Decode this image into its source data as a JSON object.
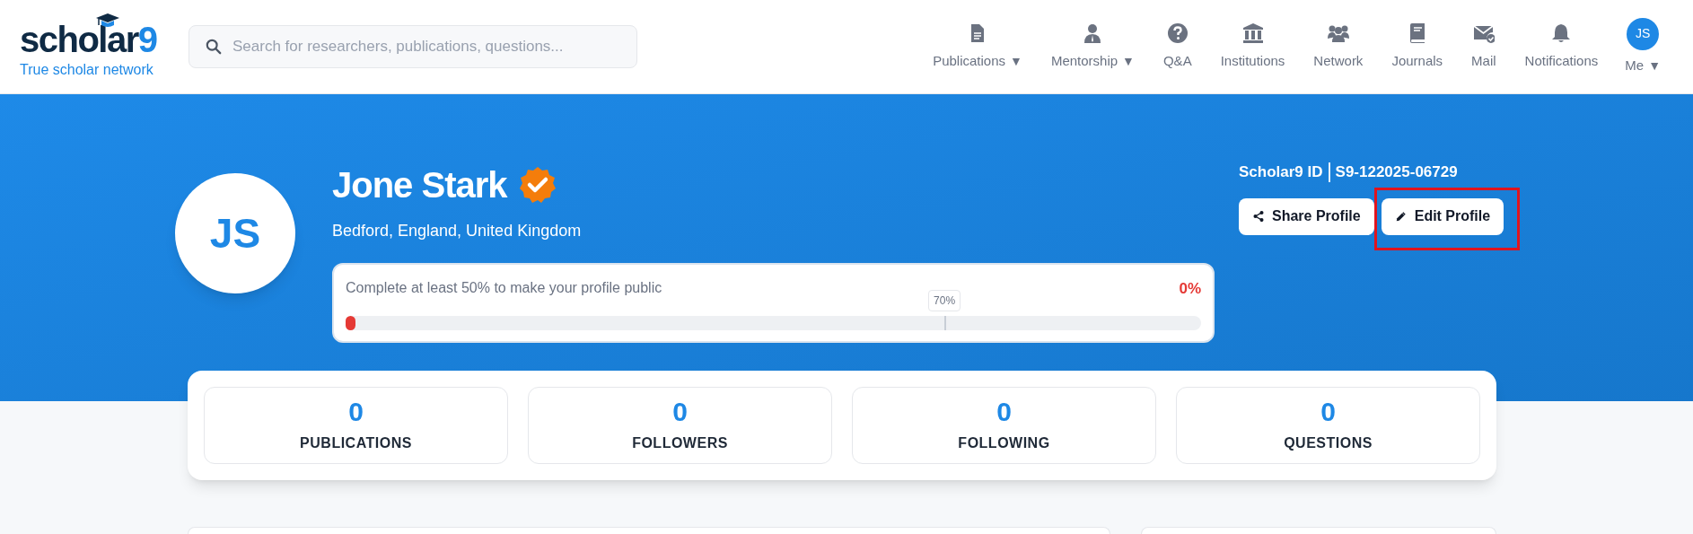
{
  "header": {
    "logo": {
      "name": "scholar",
      "digit": "9",
      "tagline": "True scholar network"
    },
    "search": {
      "placeholder": "Search for researchers, publications, questions..."
    },
    "nav": [
      {
        "kind": "doc",
        "label": "Publications",
        "caret": "▼"
      },
      {
        "kind": "person",
        "label": "Mentorship",
        "caret": "▼"
      },
      {
        "kind": "question",
        "label": "Q&A"
      },
      {
        "kind": "bank",
        "label": "Institutions"
      },
      {
        "kind": "group",
        "label": "Network"
      },
      {
        "kind": "book",
        "label": "Journals"
      },
      {
        "kind": "mail",
        "label": "Mail"
      },
      {
        "kind": "bell",
        "label": "Notifications"
      },
      {
        "kind": "avatar",
        "avatar": "JS",
        "label": "Me",
        "caret": "▼"
      }
    ]
  },
  "profile": {
    "initials": "JS",
    "name": "Jone Stark",
    "verified": true,
    "location": "Bedford, England, United Kingdom",
    "completion": {
      "message": "Complete at least 50% to make your profile public",
      "percent": "0%",
      "level": 0,
      "target_label": "70%"
    },
    "id_label": "Scholar9 ID",
    "id_value": "S9-122025-06729",
    "buttons": [
      {
        "kind": "share",
        "label": "Share Profile",
        "highlighted": false
      },
      {
        "kind": "edit",
        "label": "Edit Profile",
        "highlighted": true
      }
    ]
  },
  "stats": [
    {
      "value": "0",
      "label": "PUBLICATIONS"
    },
    {
      "value": "0",
      "label": "FOLLOWERS"
    },
    {
      "value": "0",
      "label": "FOLLOWING"
    },
    {
      "value": "0",
      "label": "QUESTIONS"
    }
  ]
}
